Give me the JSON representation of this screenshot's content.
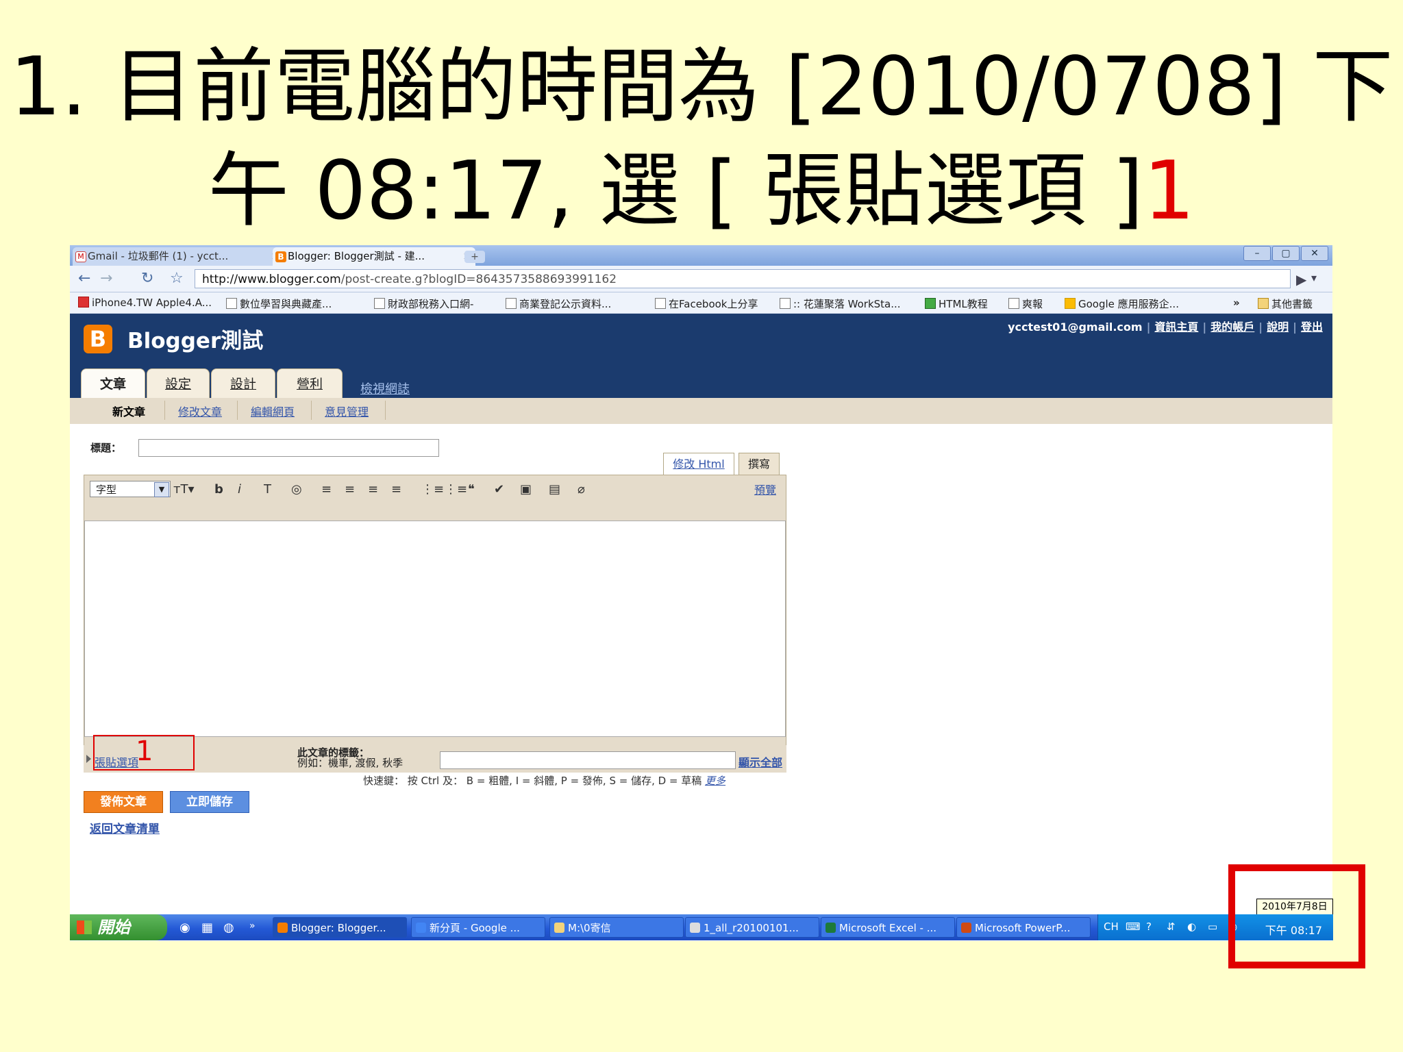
{
  "slide": {
    "title_line1": "1. 目前電腦的時間為 [2010/0708] 下",
    "title_line2": "午 08:17, 選 [ 張貼選項 ]",
    "title_num": "1"
  },
  "browser": {
    "tabs": [
      {
        "label": "Gmail - 垃圾郵件 (1) - ycct..."
      },
      {
        "label": "Blogger: Blogger測試 - 建..."
      }
    ],
    "new_tab": "+",
    "window_buttons": [
      "–",
      "▢",
      "✕"
    ],
    "url_host": "http://www.blogger.com",
    "url_path": "/post-create.g?blogID=8643573588693991162",
    "bookmarks": [
      "iPhone4.TW Apple4.A...",
      "數位學習與典藏產...",
      "財政部稅務入口網-",
      "商業登記公示資料...",
      "在Facebook上分享",
      ":: 花蓮聚落 WorkSta...",
      "HTML教程",
      "爽報",
      "Google 應用服務企..."
    ],
    "bookmarks_more": "»",
    "other_bookmarks": "其他書籤"
  },
  "blogger": {
    "logo": "B",
    "title": "Blogger測試",
    "email": "ycctest01@gmail.com",
    "links": [
      "資訊主頁",
      "我的帳戶",
      "說明",
      "登出"
    ],
    "tabs": [
      "文章",
      "設定",
      "設計",
      "營利"
    ],
    "view_blog": "檢視網誌",
    "subnav": [
      "新文章",
      "修改文章",
      "編輯網頁",
      "意見管理"
    ],
    "title_label": "標題：",
    "mode_tabs": {
      "edit_html": "修改 Html",
      "compose": "撰寫"
    },
    "font_select": "字型",
    "preview": "預覽",
    "post_options": "張貼選項",
    "labels_label": "此文章的標籤：",
    "labels_example": "例如：機車, 渡假, 秋季",
    "show_all": "顯示全部",
    "shortcuts": "快速鍵： 按 Ctrl 及： B = 粗體, I = 斜體, P = 發佈, S = 儲存, D = 草稿",
    "shortcuts_more": "更多",
    "publish_button": "發佈文章",
    "save_button": "立即儲存",
    "back_link": "返回文章清單"
  },
  "annotation": {
    "number": "1"
  },
  "taskbar": {
    "start": "開始",
    "quick_more": "»",
    "tasks": [
      "Blogger: Blogger...",
      "新分頁 - Google ...",
      "M:\\0寄信",
      "1_all_r20100101...",
      "Microsoft Excel - ...",
      "Microsoft PowerP..."
    ],
    "lang": "CH",
    "date_tooltip": "2010年7月8日",
    "clock": "下午 08:17"
  },
  "colors": {
    "slide_bg": "#ffffcc",
    "highlight": "#e00000",
    "blogger_header": "#1b3b6e",
    "publish": "#f2801f",
    "save": "#5c8fe0",
    "link": "#3355aa"
  }
}
